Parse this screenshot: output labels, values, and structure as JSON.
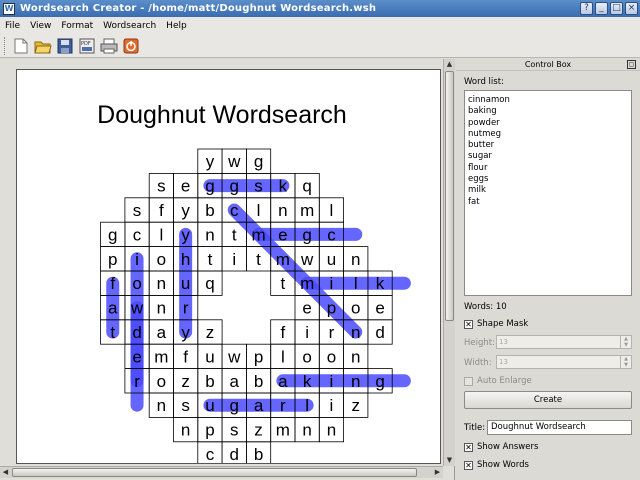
{
  "window": {
    "title": "Wordsearch Creator - /home/matt/Doughnut Wordsearch.wsh",
    "app_icon": "W"
  },
  "menu": [
    "File",
    "View",
    "Format",
    "Wordsearch",
    "Help"
  ],
  "toolbar": [
    {
      "icon": "new-document-icon"
    },
    {
      "icon": "open-folder-icon"
    },
    {
      "icon": "save-icon"
    },
    {
      "icon": "export-pdf-icon"
    },
    {
      "icon": "print-icon"
    },
    {
      "icon": "quit-icon"
    }
  ],
  "puzzle": {
    "title": "Doughnut Wordsearch",
    "grid_offset_col": 0,
    "rows": [
      "      ywg   ",
      "    seggskq ",
      "   sfybclnml",
      "  gclyntmegc",
      "  piohtitmwun",
      "  fonuq  tmilk",
      "  awnr    epoe",
      "  tdayz  firnd",
      "   emfuwploon",
      "   rozbabaking",
      "    nsugarliz",
      "     npszmnn",
      "      cdb"
    ]
  },
  "control_box": {
    "header": "Control Box",
    "word_list_label": "Word list:",
    "words": [
      "cinnamon",
      "baking",
      "powder",
      "nutmeg",
      "butter",
      "sugar",
      "flour",
      "eggs",
      "milk",
      "fat"
    ],
    "words_count_label": "Words: 10",
    "shape_mask_label": "Shape Mask",
    "shape_mask_checked": true,
    "height_label": "Height:",
    "height_value": "13",
    "width_label": "Width:",
    "width_value": "13",
    "auto_enlarge_label": "Auto Enlarge",
    "create_label": "Create",
    "title_label": "Title:",
    "title_value": "Doughnut Wordsearch",
    "show_answers_label": "Show Answers",
    "show_words_label": "Show Words"
  },
  "colors": {
    "highlight": "#4a4aff",
    "title_bar": "#3a6cb0"
  }
}
